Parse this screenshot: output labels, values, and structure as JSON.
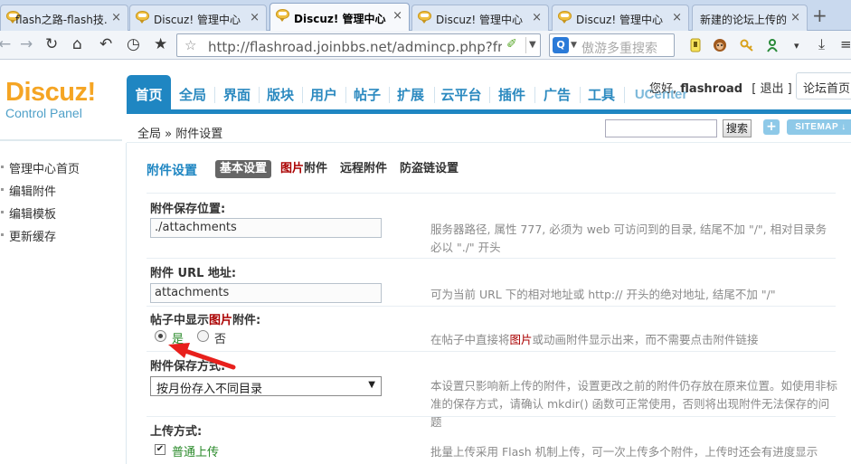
{
  "browser": {
    "tabs": [
      {
        "title": "flash之路-flash技..."
      },
      {
        "title": "Discuz! 管理中心"
      },
      {
        "title": "Discuz! 管理中心"
      },
      {
        "title": "Discuz! 管理中心"
      },
      {
        "title": "Discuz! 管理中心"
      },
      {
        "title": "新建的论坛上传的图..."
      }
    ],
    "tab_close": "×",
    "new_tab": "+",
    "url": "http://flashroad.joinbbs.net/admincp.php?frames",
    "search_placeholder": "傲游多重搜索",
    "search_engine": "Q",
    "icons": [
      "back-icon",
      "forward-icon",
      "reload-icon",
      "home-icon",
      "undo-icon",
      "history-icon",
      "bookmark-star-icon",
      "plugin-icon",
      "search-engine-icon",
      "note-icon",
      "monkey-icon",
      "key-icon",
      "person-icon",
      "menu-icon",
      "download-icon",
      "hamburger-icon"
    ]
  },
  "dz": {
    "logo_text": "Discuz!",
    "logo_sub": "Control Panel",
    "nav": [
      "首页",
      "全局",
      "界面",
      "版块",
      "用户",
      "帖子",
      "扩展",
      "云平台",
      "插件",
      "广告",
      "工具",
      "UCenter"
    ],
    "greeting": "您好,",
    "username": "flashroad",
    "logout": "[ 退出 ]",
    "forum_home": "论坛首页",
    "breadcrumb": "全局 » 附件设置",
    "search_btn": "搜索",
    "plus": "+",
    "sitemap": "SITEMAP ↓"
  },
  "left_menu": [
    "管理中心首页",
    "编辑附件",
    "编辑模板",
    "更新缓存"
  ],
  "page": {
    "title": "附件设置",
    "subtabs": {
      "basic": "基本设置",
      "image_red": "图片",
      "image_rest": "附件",
      "remote": "远程附件",
      "antileech": "防盗链设置"
    },
    "fields": {
      "save_path": {
        "label": "附件保存位置:",
        "value": "./attachments",
        "tip": "服务器路径, 属性 777, 必须为 web 可访问到的目录, 结尾不加 \"/\", 相对目录务必以 \"./\" 开头"
      },
      "url": {
        "label": "附件 URL 地址:",
        "value": "attachments",
        "tip": "可为当前 URL 下的相对地址或 http:// 开头的绝对地址, 结尾不加 \"/\""
      },
      "show_image": {
        "label_pre": "帖子中显示",
        "label_red": "图片",
        "label_post": "附件:",
        "yes": "是",
        "no": "否",
        "tip_pre": "在帖子中直接将",
        "tip_red": "图片",
        "tip_post": "或动画附件显示出来，而不需要点击附件链接"
      },
      "save_mode": {
        "label": "附件保存方式:",
        "selected": "按月份存入不同目录",
        "tip": "本设置只影响新上传的附件，设置更改之前的附件仍存放在原来位置。如使用非标准的保存方式，请确认 mkdir() 函数可正常使用，否则将出现附件无法保存的问题"
      },
      "upload_mode": {
        "label": "上传方式:",
        "option": "普通上传",
        "tip": "批量上传采用 Flash 机制上传，可一次上传多个附件，上传时还会有进度显示"
      }
    }
  },
  "colors": {
    "accent": "#1f86c2",
    "logo": "#f5a524",
    "red_text": "#aa0000",
    "green_text": "#2a8a2a",
    "annotation_arrow": "#e8201c"
  }
}
